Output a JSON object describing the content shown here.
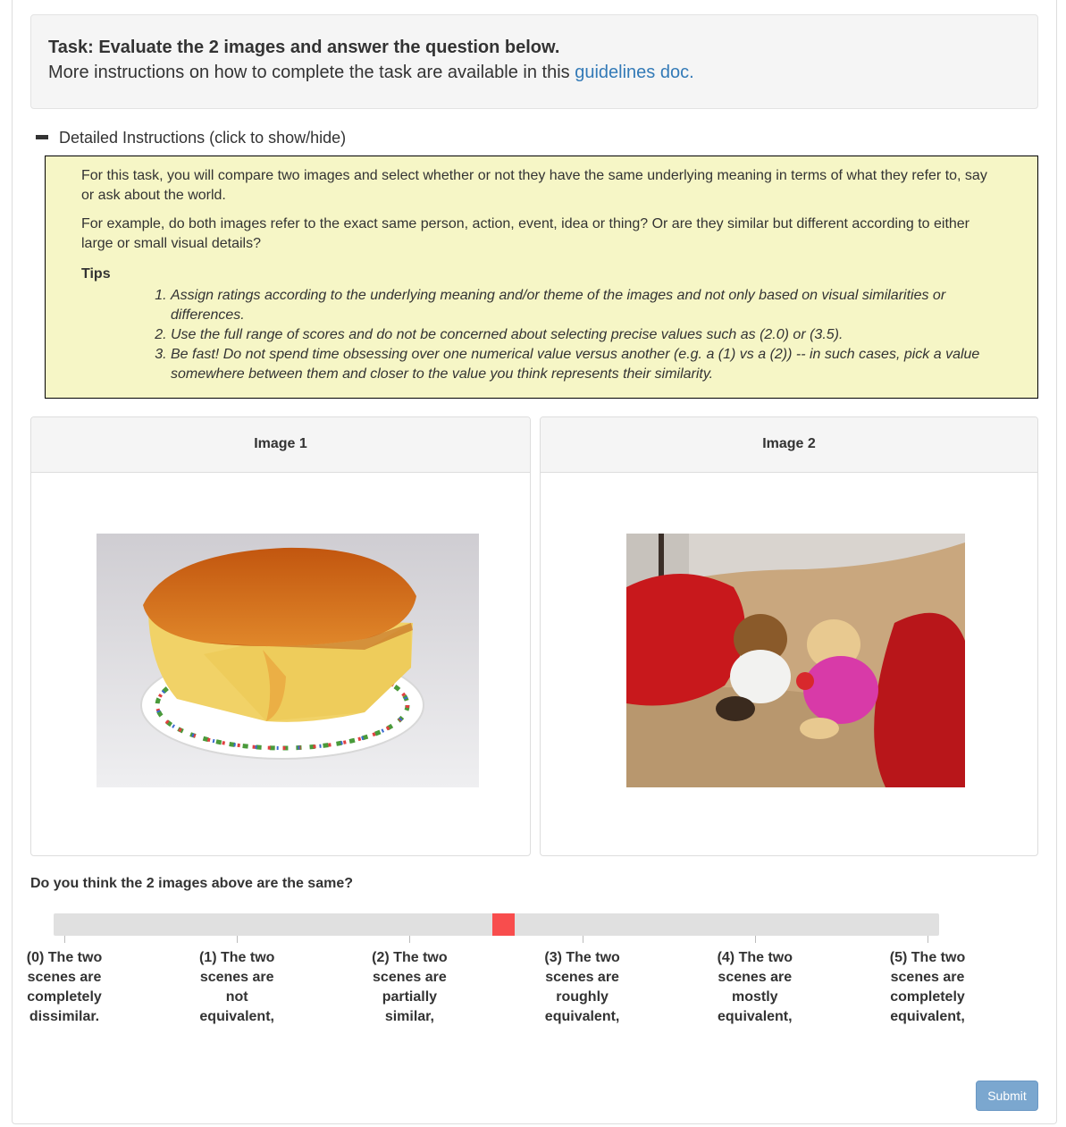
{
  "task": {
    "title": "Task: Evaluate the 2 images and answer the question below.",
    "subtitle_prefix": "More instructions on how to complete the task are available in this ",
    "guidelines_link": "guidelines doc."
  },
  "instructions": {
    "toggle_label": "Detailed Instructions (click to show/hide)",
    "paragraph1": "For this task, you will compare two images and select whether or not they have the same underlying meaning in terms of what they refer to, say or ask about the world.",
    "paragraph2": "For example, do both images refer to the exact same person, action, event, idea or thing? Or are they similar but different according to either large or small visual details?",
    "tips_label": "Tips",
    "tips": [
      "Assign ratings according to the underlying meaning and/or theme of the images and not only based on visual similarities or differences.",
      "Use the full range of scores and do not be concerned about selecting precise values such as (2.0) or (3.5).",
      "Be fast! Do not spend time obsessing over one numerical value versus another (e.g. a (1) vs a (2)) -- in such cases, pick a value somewhere between them and closer to the value you think represents their similarity."
    ]
  },
  "images": {
    "image1_title": "Image 1",
    "image2_title": "Image 2"
  },
  "question": {
    "text": "Do you think the 2 images above are the same?",
    "slider_value": 2.5,
    "slider_min": 0,
    "slider_max": 5,
    "labels": [
      "(0) The two scenes are completely dissimilar.",
      "(1) The two scenes are not equivalent,",
      "(2) The two scenes are partially similar,",
      "(3) The two scenes are roughly equivalent,",
      "(4) The two scenes are mostly equivalent,",
      "(5) The two scenes are completely equivalent,"
    ]
  },
  "submit_label": "Submit",
  "colors": {
    "link": "#337ab7",
    "instructions_bg": "#f6f6c6",
    "slider_handle": "#f84d4d",
    "submit_bg": "#7ba7cf"
  }
}
